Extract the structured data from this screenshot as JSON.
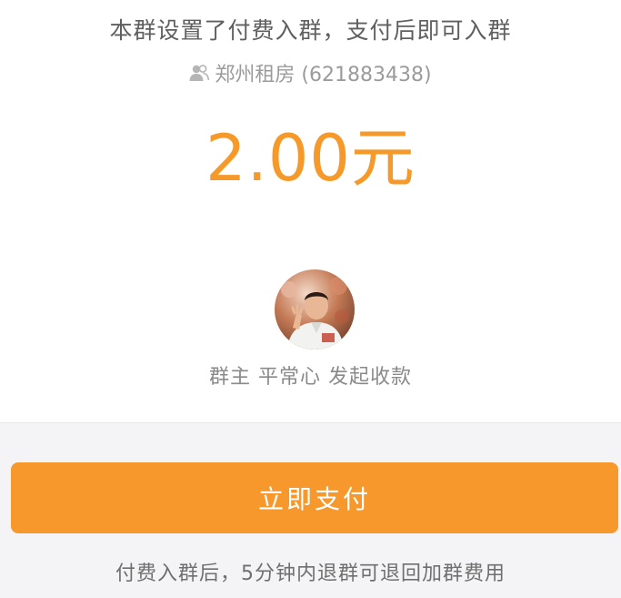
{
  "notice_text": "本群设置了付费入群，支付后即可入群",
  "group": {
    "icon": "group-members-icon",
    "name_with_id": "郑州租房 (621883438)"
  },
  "amount_text": "2.00元",
  "collector": {
    "avatar": "user-avatar",
    "text": "群主 平常心 发起收款"
  },
  "pay_button_label": "立即支付",
  "refund_note": "付费入群后，5分钟内退群可退回加群费用",
  "colors": {
    "accent": "#f7982c",
    "amount": "#f59a2a",
    "background_bottom": "#f4f4f6"
  }
}
